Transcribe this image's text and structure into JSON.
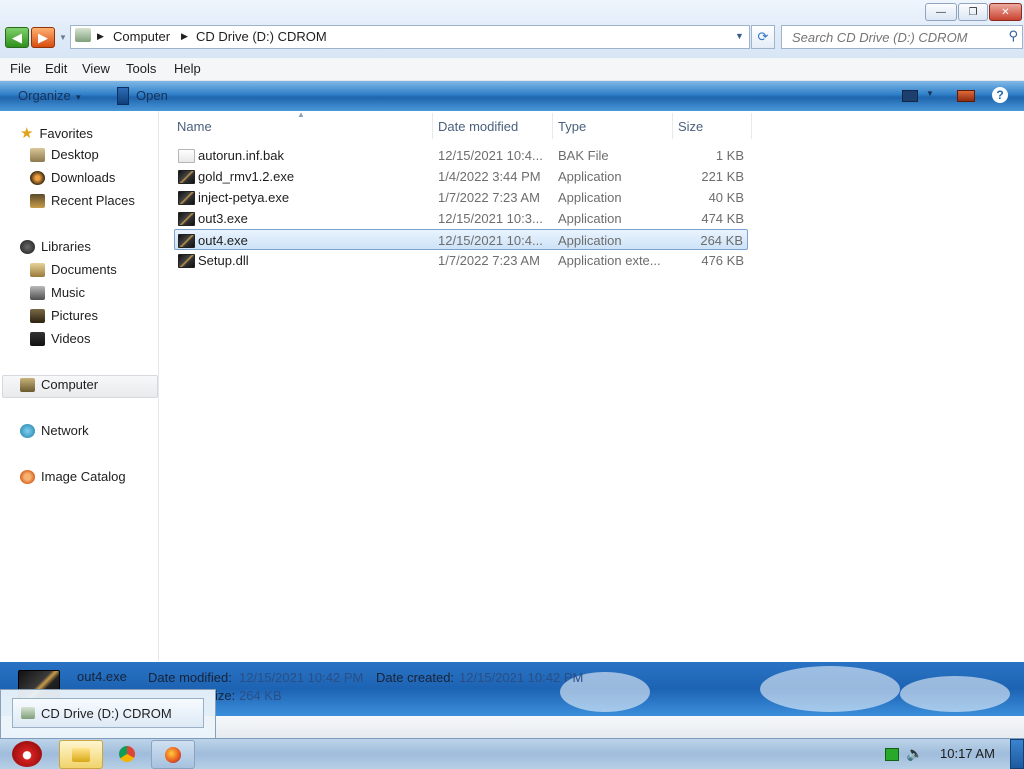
{
  "window": {
    "minimize_glyph": "—",
    "maximize_glyph": "❐",
    "close_glyph": "✕"
  },
  "address": {
    "crumbs": [
      "Computer",
      "CD Drive (D:) CDROM"
    ],
    "refresh_glyph": "⟳"
  },
  "search": {
    "placeholder": "Search CD Drive (D:) CDROM"
  },
  "menu": [
    "File",
    "Edit",
    "View",
    "Tools",
    "Help"
  ],
  "toolbar": {
    "organize_label": "Organize",
    "open_label": "Open"
  },
  "nav": {
    "favorites": "Favorites",
    "desktop": "Desktop",
    "downloads": "Downloads",
    "recent": "Recent Places",
    "libraries": "Libraries",
    "documents": "Documents",
    "music": "Music",
    "pictures": "Pictures",
    "videos": "Videos",
    "computer": "Computer",
    "network": "Network",
    "image_catalog": "Image Catalog"
  },
  "columns": [
    "Name",
    "Date modified",
    "Type",
    "Size"
  ],
  "files": [
    {
      "name": "autorun.inf.bak",
      "modified": "12/15/2021 10:4...",
      "type": "BAK File",
      "size": "1 KB",
      "icon": "bak-file-icon",
      "selected": false
    },
    {
      "name": "gold_rmv1.2.exe",
      "modified": "1/4/2022 3:44 PM",
      "type": "Application",
      "size": "221 KB",
      "icon": "application-icon",
      "selected": false
    },
    {
      "name": "inject-petya.exe",
      "modified": "1/7/2022 7:23 AM",
      "type": "Application",
      "size": "40 KB",
      "icon": "application-icon",
      "selected": false
    },
    {
      "name": "out3.exe",
      "modified": "12/15/2021 10:3...",
      "type": "Application",
      "size": "474 KB",
      "icon": "application-icon",
      "selected": false
    },
    {
      "name": "out4.exe",
      "modified": "12/15/2021 10:4...",
      "type": "Application",
      "size": "264 KB",
      "icon": "application-icon",
      "selected": true
    },
    {
      "name": "Setup.dll",
      "modified": "1/7/2022 7:23 AM",
      "type": "Application exte...",
      "size": "476 KB",
      "icon": "application-icon",
      "selected": false
    }
  ],
  "details": {
    "name": "out4.exe",
    "modified_label": "Date modified:",
    "modified_value": "12/15/2021 10:42 PM",
    "created_label": "Date created:",
    "created_value": "12/15/2021 10:42 PM",
    "size_label": "ize:",
    "size_value": "264 KB"
  },
  "preview": {
    "label": "CD Drive (D:) CDROM"
  },
  "taskbar": {
    "clock": "10:17 AM"
  }
}
